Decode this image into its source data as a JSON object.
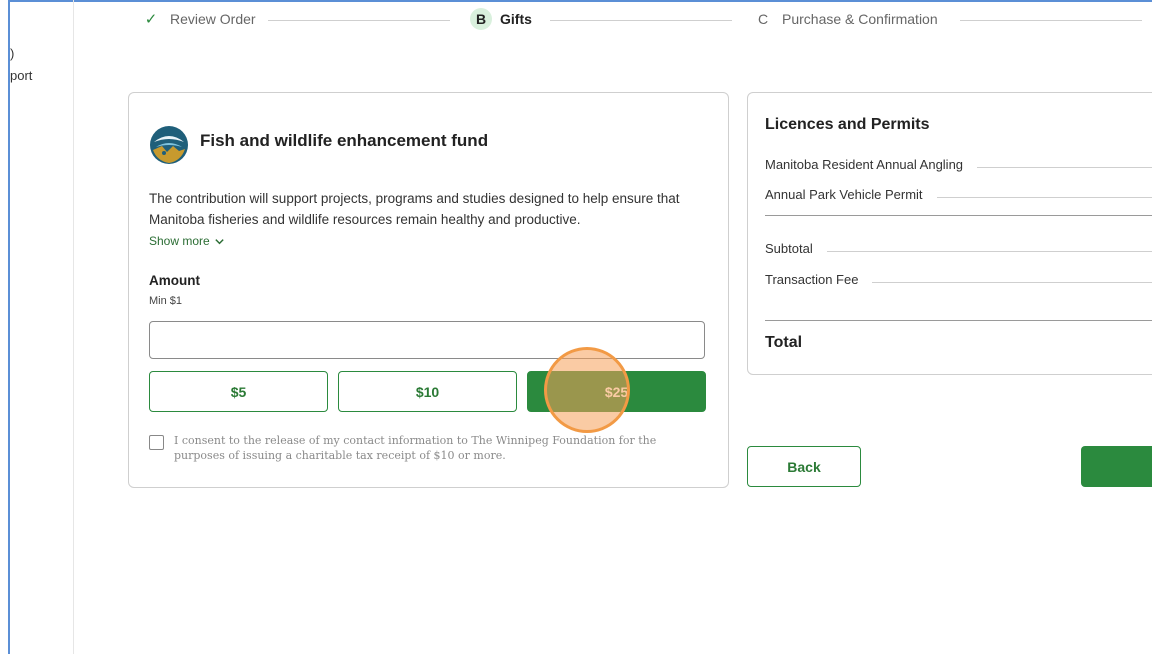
{
  "sidebar": {
    "fragment_1": ")",
    "fragment_2": "port"
  },
  "stepper": {
    "steps": [
      {
        "icon": "checkmark-icon",
        "label": "Review Order",
        "state": "completed"
      },
      {
        "marker": "B",
        "label": "Gifts",
        "state": "active"
      },
      {
        "marker": "C",
        "label": "Purchase & Confirmation",
        "state": "upcoming"
      }
    ]
  },
  "fund": {
    "logo_icon": "fund-logo-icon",
    "title": "Fish and wildlife enhancement fund",
    "description": "The contribution will support projects, programs and studies designed to help ensure that Manitoba fisheries and wildlife resources remain healthy and productive.",
    "show_more_label": "Show more",
    "amount_label": "Amount",
    "amount_min": "Min $1",
    "amount_value": "",
    "quick_amounts": [
      "$5",
      "$10",
      "$25"
    ],
    "selected_amount": "$25",
    "consent_checked": false,
    "consent_text": "I consent to the release of my contact information to The Winnipeg Foundation for the purposes of issuing a charitable tax receipt of $10 or more."
  },
  "summary": {
    "title": "Licences and Permits",
    "items": [
      "Manitoba Resident Annual Angling",
      "Annual Park Vehicle Permit"
    ],
    "subtotal_label": "Subtotal",
    "fee_label": "Transaction Fee",
    "total_label": "Total"
  },
  "actions": {
    "back_label": "Back"
  },
  "colors": {
    "primary_green": "#2b8a3e",
    "click_marker": "#f29a45",
    "frame_blue": "#5b8fd6"
  }
}
